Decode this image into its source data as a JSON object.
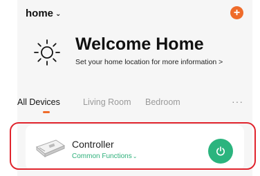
{
  "header": {
    "home_label": "home",
    "add_icon": "plus-icon"
  },
  "welcome": {
    "title": "Welcome Home",
    "subtitle": "Set your home location for more information  >",
    "icon": "sun-icon"
  },
  "tabs": [
    {
      "label": "All Devices",
      "active": true
    },
    {
      "label": "Living Room",
      "active": false
    },
    {
      "label": "Bedroom",
      "active": false
    }
  ],
  "tabs_more": "···",
  "device": {
    "name": "Controller",
    "functions_label": "Common Functions",
    "power_icon": "power-icon"
  },
  "colors": {
    "accent": "#ef6b2a",
    "power_green": "#2bb47e",
    "functions_green": "#2db07a",
    "highlight_red": "#e0232c"
  }
}
